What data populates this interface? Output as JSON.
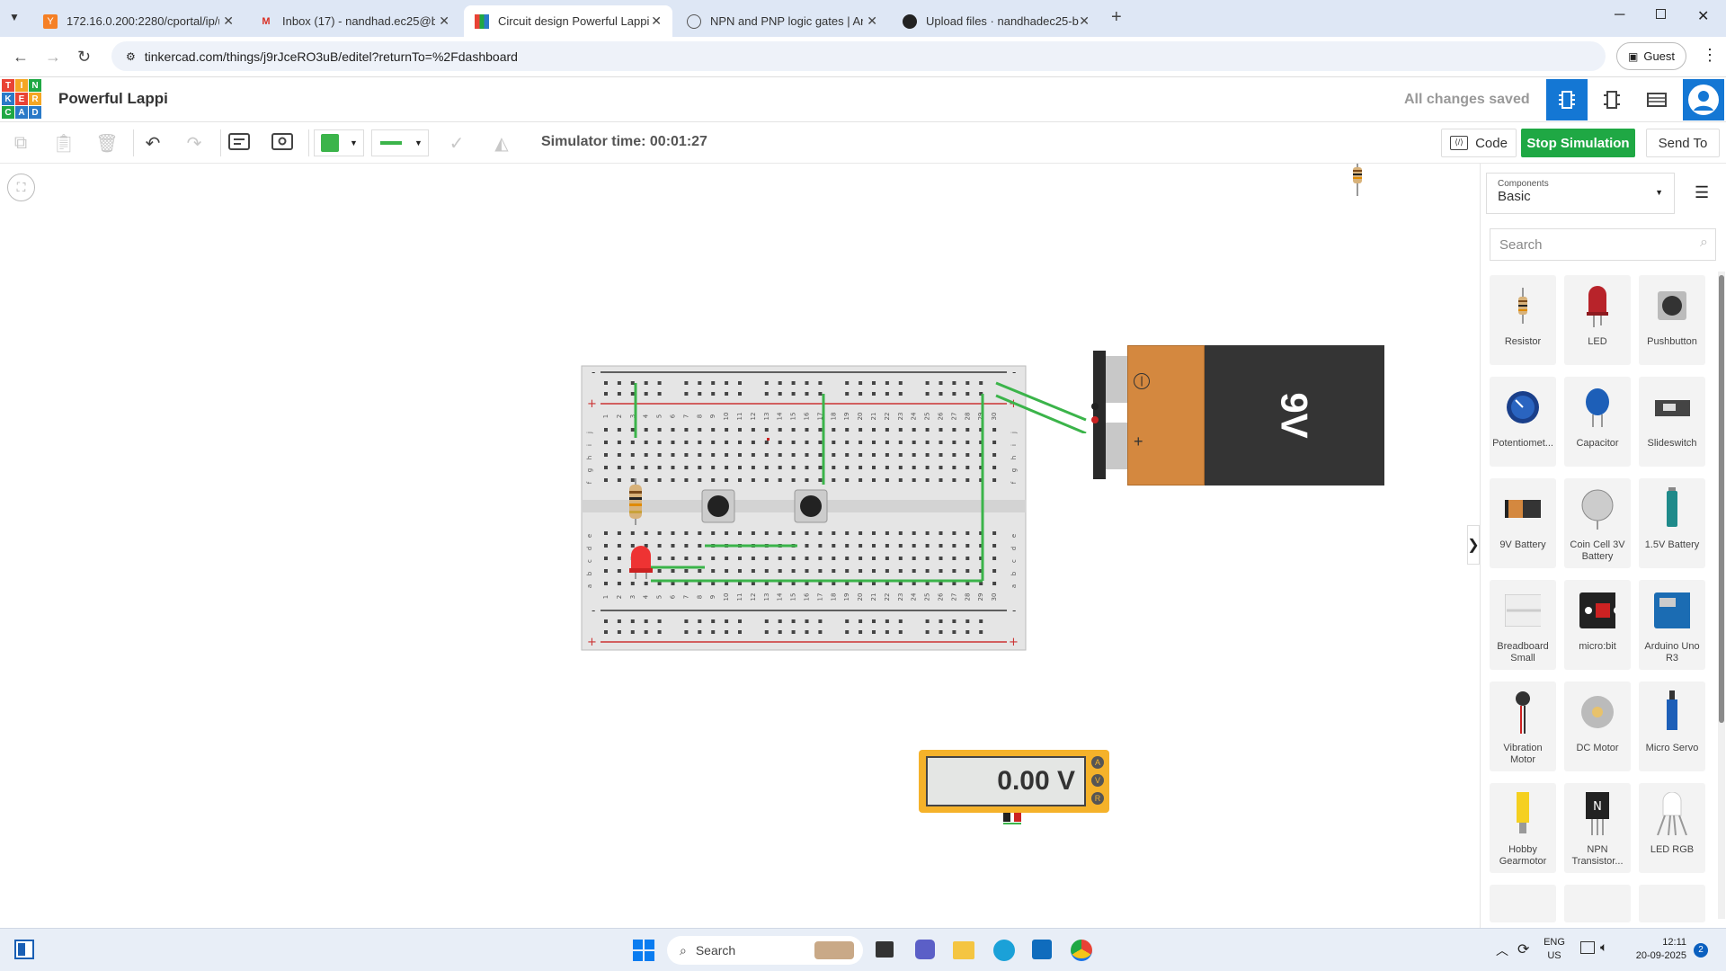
{
  "browser": {
    "tabs": [
      {
        "title": "172.16.0.200:2280/cportal/ip/u",
        "icon": "y-icon"
      },
      {
        "title": "Inbox (17) - nandhad.ec25@bit",
        "icon": "gmail-icon"
      },
      {
        "title": "Circuit design Powerful Lappi -",
        "icon": "tinkercad-icon"
      },
      {
        "title": "NPN and PNP logic gates | And",
        "icon": "globe-icon"
      },
      {
        "title": "Upload files · nandhadec25-blip",
        "icon": "github-icon"
      }
    ],
    "url": "tinkercad.com/things/j9rJceRO3uB/editel?returnTo=%2Fdashboard",
    "profile": "Guest"
  },
  "app": {
    "logo": [
      "T",
      "I",
      "N",
      "K",
      "E",
      "R",
      "C",
      "A",
      "D"
    ],
    "project_name": "Powerful Lappi",
    "save_status": "All changes saved",
    "sim_time": "Simulator time: 00:01:27",
    "code_label": "Code",
    "stop_label": "Stop Simulation",
    "send_label": "Send To",
    "accent": "#1fa844"
  },
  "canvas": {
    "battery_label": "9V",
    "meter_reading": "0.00 V",
    "meter_modes": [
      "A",
      "V",
      "R"
    ],
    "bb_cols_top": [
      "1",
      "2",
      "3",
      "4",
      "5",
      "6",
      "7",
      "8",
      "9",
      "10",
      "11",
      "12",
      "13",
      "14",
      "15",
      "16",
      "17",
      "18",
      "19",
      "20",
      "21",
      "22",
      "23",
      "24",
      "25",
      "26",
      "27",
      "28",
      "29",
      "30"
    ],
    "bb_rows_top": [
      "j",
      "i",
      "h",
      "g",
      "f"
    ],
    "bb_rows_bottom": [
      "e",
      "d",
      "c",
      "b",
      "a"
    ],
    "rail_minus": "-",
    "rail_plus": "+"
  },
  "panel": {
    "components_label": "Components",
    "components_value": "Basic",
    "search_placeholder": "Search",
    "items": [
      {
        "label": "Resistor"
      },
      {
        "label": "LED"
      },
      {
        "label": "Pushbutton"
      },
      {
        "label": "Potentiomet..."
      },
      {
        "label": "Capacitor"
      },
      {
        "label": "Slideswitch"
      },
      {
        "label": "9V Battery"
      },
      {
        "label": "Coin Cell 3V Battery"
      },
      {
        "label": "1.5V Battery"
      },
      {
        "label": "Breadboard Small"
      },
      {
        "label": "micro:bit"
      },
      {
        "label": "Arduino Uno R3"
      },
      {
        "label": "Vibration Motor"
      },
      {
        "label": "DC Motor"
      },
      {
        "label": "Micro Servo"
      },
      {
        "label": "Hobby Gearmotor"
      },
      {
        "label": "NPN Transistor..."
      },
      {
        "label": "LED RGB"
      }
    ]
  },
  "taskbar": {
    "search": "Search",
    "lang1": "ENG",
    "lang2": "US",
    "time": "12:11",
    "date": "20-09-2025",
    "badge": "2"
  }
}
